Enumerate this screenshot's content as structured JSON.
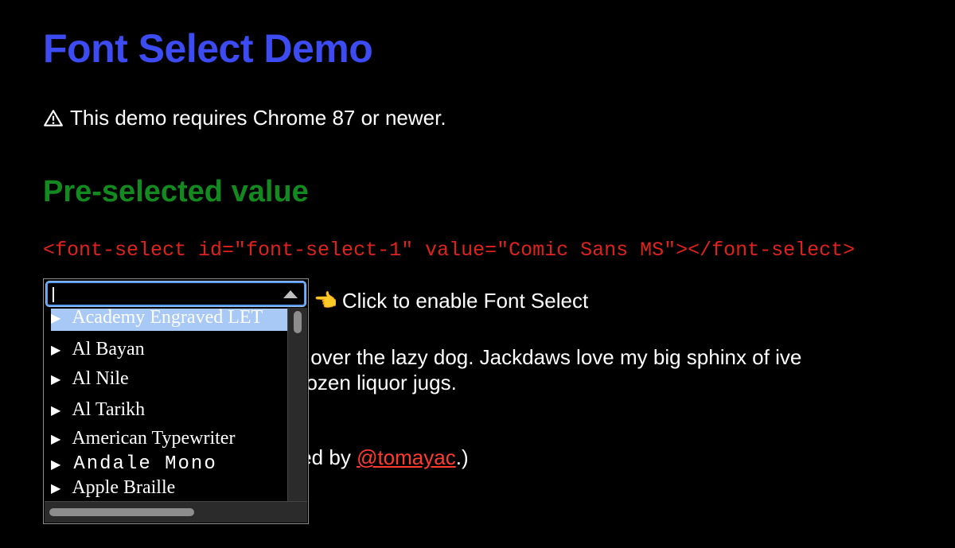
{
  "page": {
    "title": "Font Select Demo",
    "warning": "This demo requires Chrome 87 or newer.",
    "section_heading": "Pre-selected value",
    "code_sample": "<font-select id=\"font-select-1\" value=\"Comic Sans MS\"></font-select>",
    "hint": "Click to enable Font Select",
    "sample_text_visible": "s over the lazy dog. Jackdaws love my big sphinx of ive dozen liquor jugs.",
    "credit_prefix": "ted by ",
    "credit_link": "@tomayac",
    "credit_suffix": ".)"
  },
  "font_select": {
    "input_value": "",
    "items": [
      {
        "label": "Academy Engraved LET",
        "selected": true
      },
      {
        "label": "Al Bayan",
        "selected": false
      },
      {
        "label": "Al Nile",
        "selected": false
      },
      {
        "label": "Al Tarikh",
        "selected": false
      },
      {
        "label": "American Typewriter",
        "selected": false
      },
      {
        "label": "Andale Mono",
        "selected": false
      },
      {
        "label": "Apple Braille",
        "selected": false
      }
    ]
  },
  "colors": {
    "title": "#3d4cf2",
    "section_heading": "#138a1f",
    "code": "#e0221c",
    "link": "#ff3b30",
    "focus_ring": "#5b9df0",
    "selected_item": "#a8c8f5"
  }
}
